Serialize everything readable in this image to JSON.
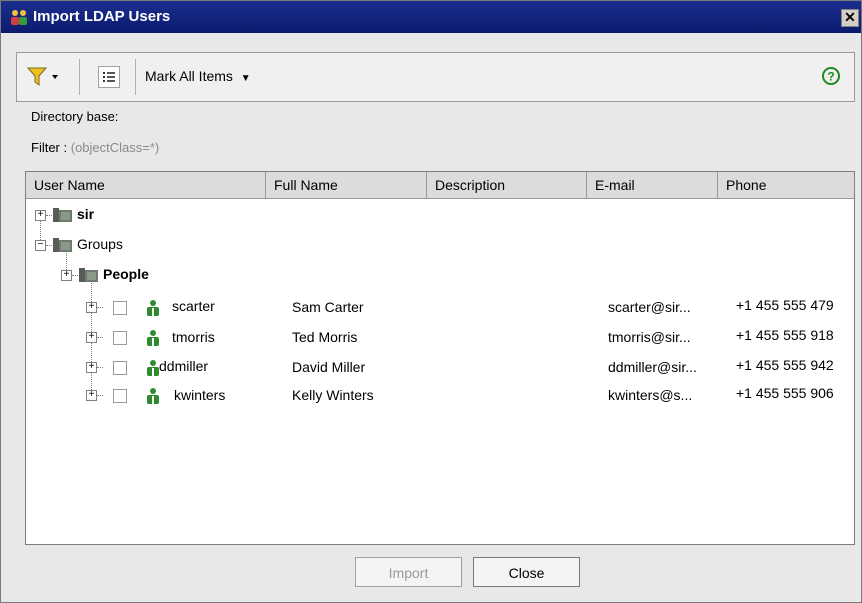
{
  "window": {
    "title": "Import LDAP Users",
    "close_glyph": "✕"
  },
  "toolbar": {
    "filter_icon": "filter-icon",
    "list_icon": "list-icon",
    "mark_all_label": "Mark All Items",
    "help_icon": "help-icon"
  },
  "info": {
    "directory_base_label": "Directory base:",
    "filter_label": "Filter :",
    "filter_value": "(objectClass=*)"
  },
  "grid": {
    "columns": [
      "User Name",
      "Full Name",
      "Description",
      "E-mail",
      "Phone"
    ],
    "tree": [
      {
        "label": "sir",
        "bold": true
      },
      {
        "label": "Groups",
        "bold": false
      },
      {
        "label": "People",
        "bold": true
      }
    ],
    "users": [
      {
        "username": "scarter",
        "full_name": "Sam Carter",
        "description": "",
        "email": "scarter@sir...",
        "phone": "+1 455 555 479"
      },
      {
        "username": "tmorris",
        "full_name": "Ted Morris",
        "description": "",
        "email": "tmorris@sir...",
        "phone": "+1 455 555 918"
      },
      {
        "username": "ddmiller",
        "full_name": "David Miller",
        "description": "",
        "email": "ddmiller@sir...",
        "phone": "+1 455 555 942"
      },
      {
        "username": "kwinters",
        "full_name": "Kelly Winters",
        "description": "",
        "email": "kwinters@s...",
        "phone": "+1 455 555 906"
      }
    ]
  },
  "buttons": {
    "import_label": "Import",
    "close_label": "Close"
  },
  "colors": {
    "titlebar": "#0b1a6e",
    "help_green": "#1f8a1f",
    "user_green": "#2e8b2e",
    "filter_yellow": "#f0c020"
  }
}
